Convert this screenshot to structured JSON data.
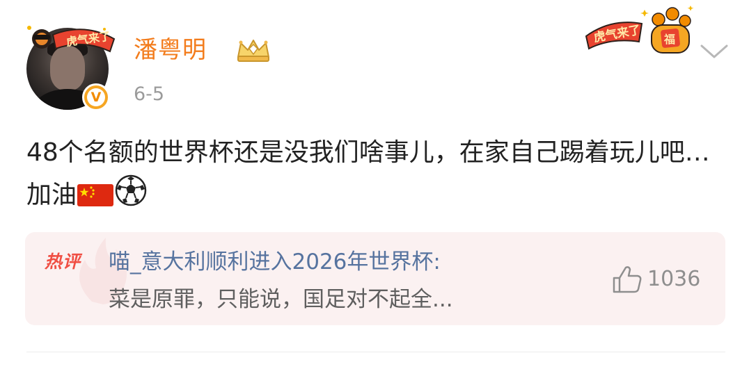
{
  "post": {
    "author": {
      "name": "潘粤明",
      "verified_mark": "V",
      "avatar_frame_text": "虎气来了",
      "avatar_icon": "avatar",
      "badge_icon": "crown-icon"
    },
    "timestamp": "6-5",
    "decoration": {
      "sticker_text": "虎气来了",
      "sticker_fu": "福"
    },
    "menu_icon": "chevron-down-icon",
    "text": "48个名额的世界杯还是没我们啥事儿，在家自己踢着玩儿吧…加油",
    "emojis": [
      "china-flag",
      "soccer-ball"
    ]
  },
  "hot_comment": {
    "label": "热评",
    "author": "喵_意大利顺利进入2026年世界杯",
    "colon": ":",
    "text": "菜是原罪，只能说，国足对不起全...",
    "like_icon": "thumbs-up-icon",
    "like_count": "1036"
  },
  "colors": {
    "username": "#f37c1c",
    "hot_label": "#f04e43",
    "comment_author": "#56739f",
    "card_bg": "#fbf1f1",
    "meta": "#9b9b9b"
  }
}
